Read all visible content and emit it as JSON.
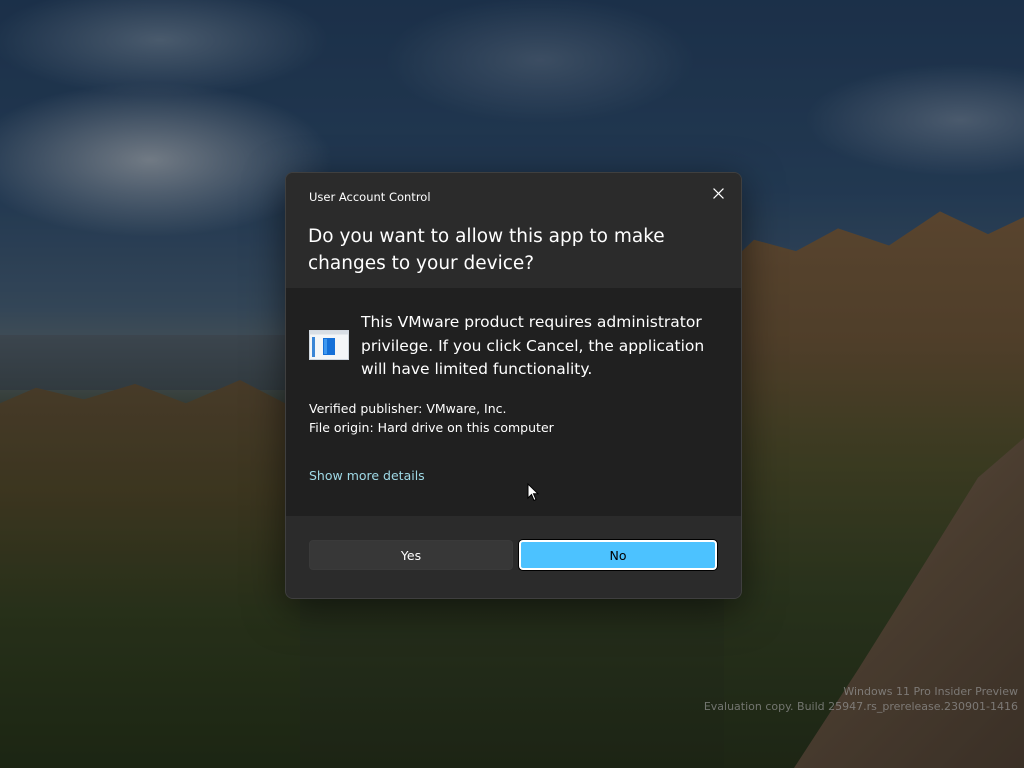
{
  "dialog": {
    "title": "User Account Control",
    "question": "Do you want to allow this app to make changes to your device?",
    "app_icon": "app-window-icon",
    "message": "This VMware product requires administrator privilege. If you click Cancel, the application will have limited functionality.",
    "publisher": "Verified publisher: VMware, Inc.",
    "file_origin": "File origin: Hard drive on this computer",
    "details_link": "Show more details",
    "yes_label": "Yes",
    "no_label": "No",
    "accent_color": "#4cc2ff"
  },
  "watermark": {
    "line1": "Windows 11 Pro Insider Preview",
    "line2": "Evaluation copy. Build 25947.rs_prerelease.230901-1416"
  }
}
